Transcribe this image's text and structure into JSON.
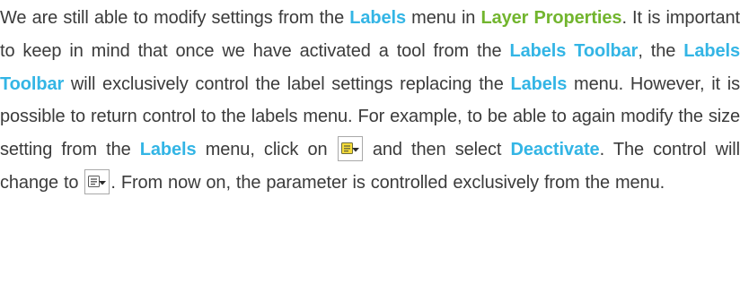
{
  "paragraph": {
    "t1": "We are still able to modify settings from the ",
    "b1": "Labels",
    "t2": " menu in ",
    "b2": "Layer Properties",
    "t3": ". It is important to keep in mind that once we have activated a tool from the ",
    "b3": "Labels Toolbar",
    "t4": ", the ",
    "b4": "Labels Toolbar",
    "t5": " will exclusively control the label settings replacing the ",
    "b5": "Labels",
    "t6": " menu. However, it is possible to return control to the labels menu. For example, to be able to again modify the size setting from the ",
    "b6": "Labels",
    "t7": " menu, click on ",
    "t8": " and then select ",
    "b7": "Deactivate",
    "t9": ". The control will change to ",
    "t10": ". From now on, the parameter is controlled exclusively from the menu."
  },
  "icons": {
    "active": "label-control-active-icon",
    "inactive": "label-control-inactive-icon"
  },
  "colors": {
    "text": "#3b3b3b",
    "label_highlight": "#33b5e5",
    "layer_properties_highlight": "#72b52e",
    "icon_active_fill": "#f7dc3a",
    "icon_inactive_fill": "#ffffff"
  }
}
